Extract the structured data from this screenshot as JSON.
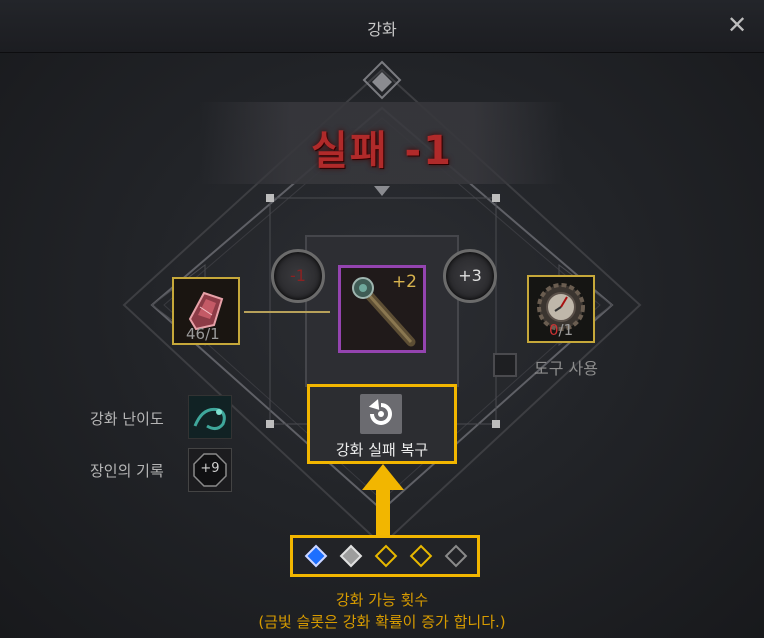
{
  "window": {
    "title": "강화",
    "close_icon": "close-icon"
  },
  "result": {
    "text": "실패 -1",
    "color": "#b02a2a"
  },
  "materials": {
    "crystal": {
      "icon": "red-crystal-icon",
      "count": "46/1"
    },
    "main_item": {
      "icon": "staff-weapon-icon",
      "level": "+2"
    },
    "tool": {
      "icon": "clock-gear-tool-icon",
      "count_have": "0",
      "count_need": "/1"
    }
  },
  "level_change": {
    "left": "-1",
    "right": "+3"
  },
  "tool_use": {
    "label": "도구 사용",
    "checked": false
  },
  "restore_button": {
    "label": "강화 실패 복구",
    "icon": "restore-icon"
  },
  "difficulty": {
    "label": "강화 난이도",
    "icon": "dragon-difficulty-icon"
  },
  "craftsman": {
    "label": "장인의 기록",
    "value": "+9"
  },
  "attempts": {
    "slots": [
      "blue",
      "silver",
      "gold",
      "gold",
      "empty"
    ],
    "caption": "강화 가능 횟수",
    "note": "(금빛 슬롯은 강화 확률이 증가 합니다.)"
  },
  "colors": {
    "accent": "#f2b600",
    "fail": "#b02a2a",
    "caption": "#d79b00",
    "selected_diamond": "#1d6fff"
  }
}
